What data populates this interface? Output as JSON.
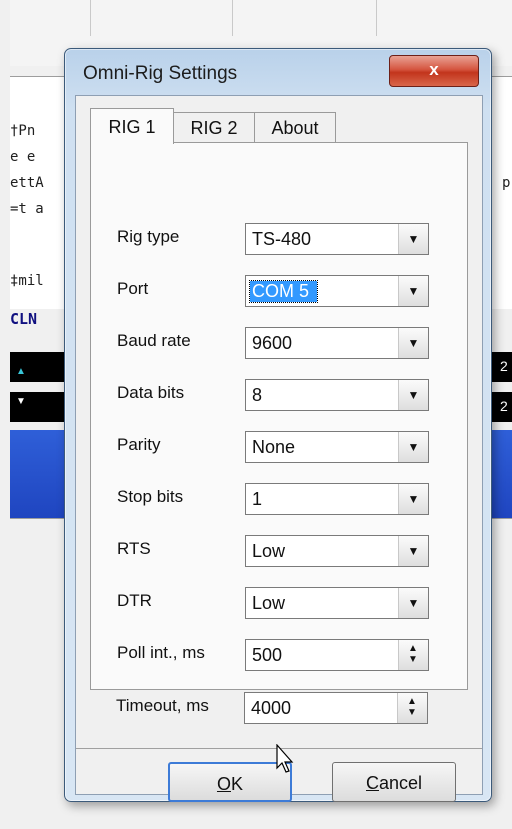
{
  "background": {
    "editor_lines": [
      "†Pn",
      "e e",
      "ettA",
      "=t a",
      "",
      "‡mil"
    ],
    "right_fragment": "p",
    "cln_label": "CLN",
    "right_digits": [
      "2",
      "2"
    ]
  },
  "dialog": {
    "title": "Omni-Rig Settings",
    "close_glyph": "x",
    "tabs": [
      {
        "label": "RIG 1",
        "active": true
      },
      {
        "label": "RIG 2",
        "active": false
      },
      {
        "label": "About",
        "active": false
      }
    ],
    "fields": [
      {
        "label": "Rig type",
        "value": "TS-480",
        "control": "dropdown"
      },
      {
        "label": "Port",
        "value": "COM 5",
        "control": "dropdown",
        "selected": true
      },
      {
        "label": "Baud rate",
        "value": "9600",
        "control": "dropdown"
      },
      {
        "label": "Data bits",
        "value": "8",
        "control": "dropdown"
      },
      {
        "label": "Parity",
        "value": "None",
        "control": "dropdown"
      },
      {
        "label": "Stop bits",
        "value": "1",
        "control": "dropdown"
      },
      {
        "label": "RTS",
        "value": "Low",
        "control": "dropdown"
      },
      {
        "label": "DTR",
        "value": "Low",
        "control": "dropdown"
      },
      {
        "label": "Poll int., ms",
        "value": "500",
        "control": "spinner"
      },
      {
        "label": "Timeout, ms",
        "value": "4000",
        "control": "spinner"
      }
    ],
    "buttons": {
      "ok": {
        "label": "OK",
        "mnemonic": "O",
        "rest": "K"
      },
      "cancel": {
        "label": "Cancel",
        "mnemonic": "C",
        "rest": "ancel"
      }
    }
  },
  "colors": {
    "selection": "#3399ff",
    "close_button": "#c2341c",
    "title_bar": "#b9d1ea",
    "background_blue": "#1f45c0"
  }
}
